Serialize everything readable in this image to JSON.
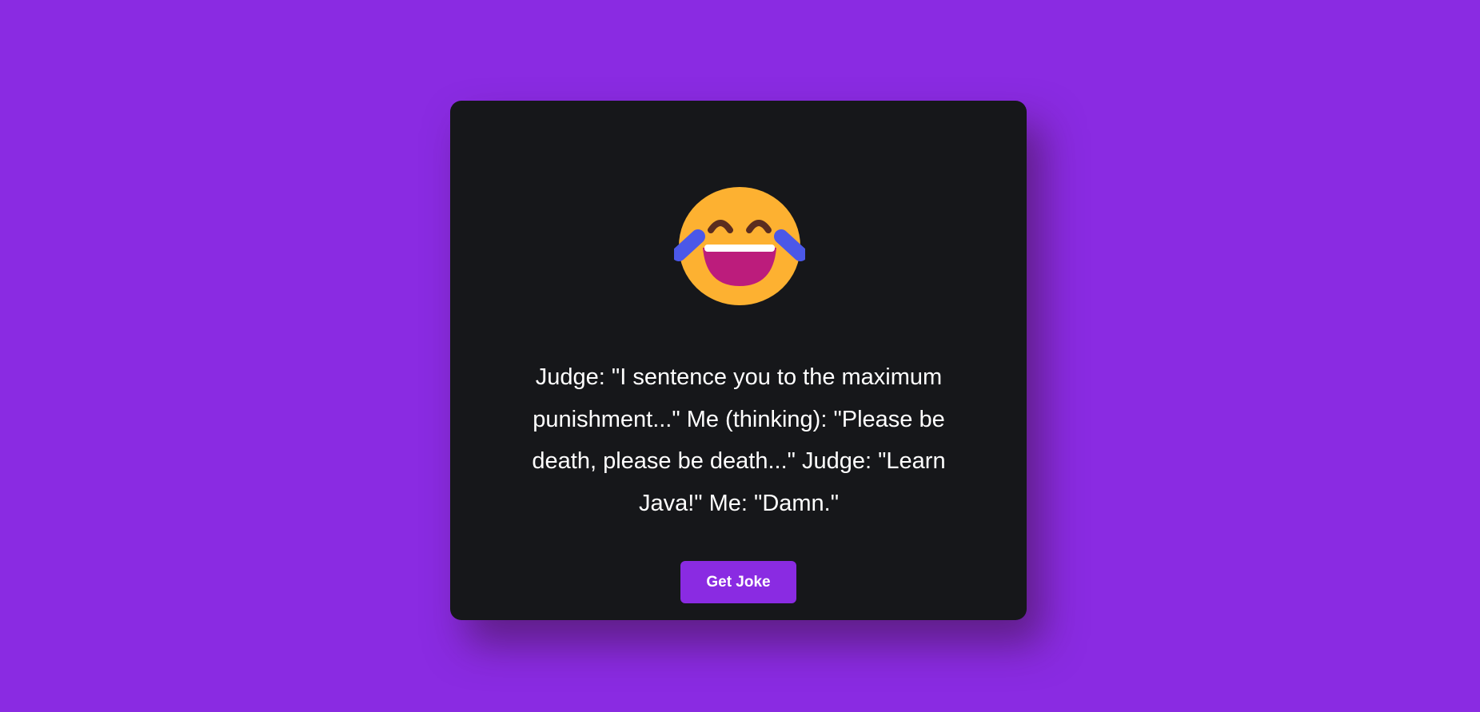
{
  "emoji": {
    "icon": "face-with-tears-of-joy-icon"
  },
  "joke": {
    "text": "Judge: \"I sentence you to the maximum punishment...\" Me (thinking): \"Please be death, please be death...\" Judge: \"Learn Java!\" Me: \"Damn.\""
  },
  "button": {
    "label": "Get Joke"
  },
  "colors": {
    "page_background": "#8a2be2",
    "card_background": "#16171a",
    "button_background": "#8a2be2",
    "text": "#ffffff"
  }
}
